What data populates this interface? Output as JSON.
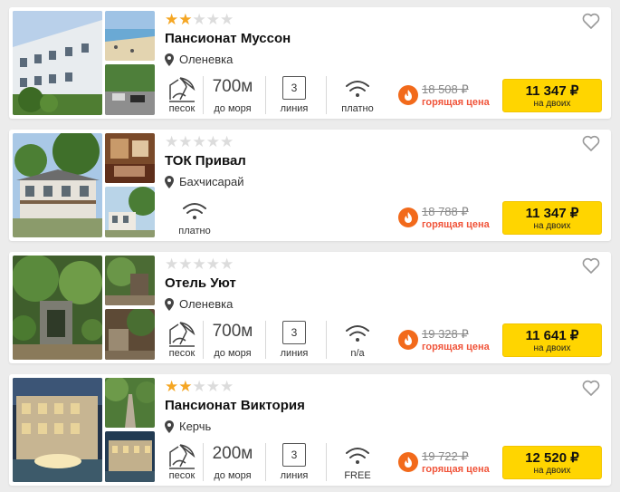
{
  "hotels": [
    {
      "name": "Пансионат Муссон",
      "stars": 2,
      "location": "Оленевка",
      "beach": "песок",
      "distance": "700м",
      "distance_caption": "до моря",
      "line": "3",
      "line_caption": "линия",
      "wifi": "платно",
      "old_price": "18 508 ₽",
      "hot_label": "горящая цена",
      "price": "11 347 ₽",
      "price_sub": "на двоих"
    },
    {
      "name": "ТОК Привал",
      "stars": 0,
      "location": "Бахчисарай",
      "wifi": "платно",
      "old_price": "18 788 ₽",
      "hot_label": "горящая цена",
      "price": "11 347 ₽",
      "price_sub": "на двоих"
    },
    {
      "name": "Отель Уют",
      "stars": 0,
      "location": "Оленевка",
      "beach": "песок",
      "distance": "700м",
      "distance_caption": "до моря",
      "line": "3",
      "line_caption": "линия",
      "wifi": "n/a",
      "old_price": "19 328 ₽",
      "hot_label": "горящая цена",
      "price": "11 641 ₽",
      "price_sub": "на двоих"
    },
    {
      "name": "Пансионат Виктория",
      "stars": 2,
      "location": "Керчь",
      "beach": "песок",
      "distance": "200м",
      "distance_caption": "до моря",
      "line": "3",
      "line_caption": "линия",
      "wifi": "FREE",
      "old_price": "19 722 ₽",
      "hot_label": "горящая цена",
      "price": "12 520 ₽",
      "price_sub": "на двоих"
    }
  ],
  "colors": {
    "star_on": "#f5a623",
    "star_off": "#dcdcdc",
    "button": "#ffd500",
    "hot": "#f0543a",
    "fire": "#f26a1b"
  },
  "icons": [
    "star-icon",
    "location-pin-icon",
    "beach-umbrella-icon",
    "wifi-icon",
    "fire-icon",
    "heart-icon"
  ]
}
